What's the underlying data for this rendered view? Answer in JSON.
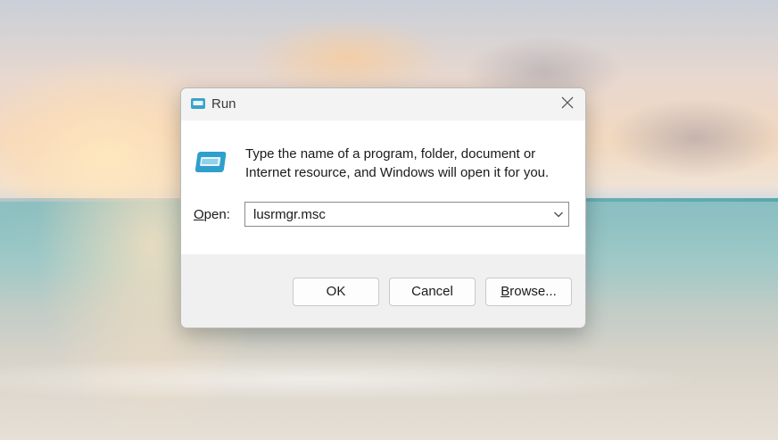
{
  "dialog": {
    "title": "Run",
    "description": "Type the name of a program, folder, document or Internet resource, and Windows will open it for you.",
    "open_label_prefix": "O",
    "open_label_rest": "pen:",
    "open_value": "lusrmgr.msc",
    "buttons": {
      "ok": "OK",
      "cancel": "Cancel",
      "browse_prefix": "B",
      "browse_rest": "rowse..."
    },
    "icons": {
      "title": "run-icon",
      "content": "run-icon",
      "close": "close-icon",
      "dropdown": "chevron-down-icon"
    }
  }
}
